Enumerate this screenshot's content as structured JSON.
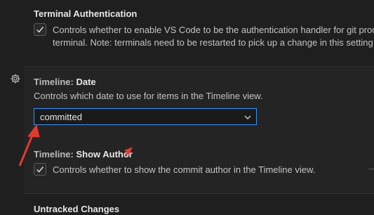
{
  "terminal_auth": {
    "title": "Terminal Authentication",
    "desc_line1": "Controls whether to enable VS Code to be the authentication handler for git process",
    "desc_line2": "terminal. Note: terminals need to be restarted to pick up a change in this setting",
    "checked": true
  },
  "timeline_date": {
    "category": "Timeline: ",
    "name": "Date",
    "description": "Controls which date to use for items in the Timeline view.",
    "selected": "committed"
  },
  "timeline_show_author": {
    "category": "Timeline: ",
    "name": "Show Author",
    "description": "Controls whether to show the commit author in the Timeline view.",
    "checked": true
  },
  "untracked_changes": {
    "title": "Untracked Changes"
  },
  "icons": {
    "settings_gear": "gear-icon",
    "checkbox_check": "check-icon",
    "dropdown": "chevron-down-icon"
  },
  "colors": {
    "background": "#1f1f1f",
    "focused_panel": "#242424",
    "focus_border": "#3794ff",
    "annotation_arrow": "#e03a2f"
  }
}
